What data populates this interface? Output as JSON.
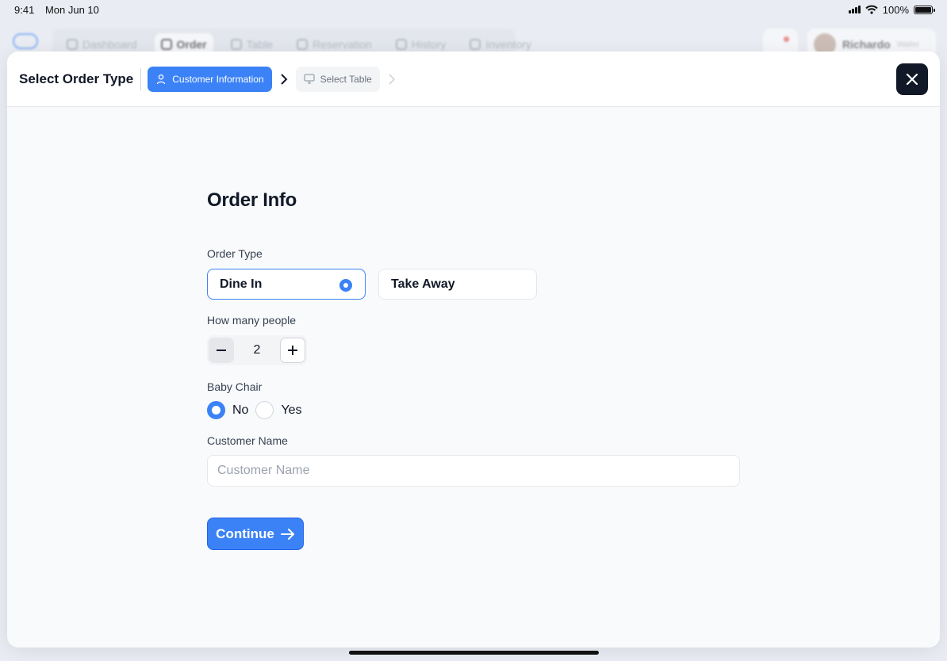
{
  "status_bar": {
    "time": "9:41",
    "date": "Mon Jun 10",
    "battery": "100%"
  },
  "background": {
    "tabs": [
      {
        "label": "Dashboard",
        "icon": "dashboard-icon",
        "active": false
      },
      {
        "label": "Order",
        "icon": "document-icon",
        "active": true
      },
      {
        "label": "Table",
        "icon": "monitor-icon",
        "active": false
      },
      {
        "label": "Reservation",
        "icon": "calendar-icon",
        "active": false
      },
      {
        "label": "History",
        "icon": "clock-icon",
        "active": false
      },
      {
        "label": "Inventory",
        "icon": "store-icon",
        "active": false
      }
    ],
    "user": {
      "name": "Richardo",
      "role": "Waiter"
    }
  },
  "modal": {
    "title": "Select Order Type",
    "steps": [
      {
        "label": "Customer Information",
        "icon": "user-icon",
        "active": true
      },
      {
        "label": "Select Table",
        "icon": "monitor-icon",
        "active": false
      }
    ],
    "close_icon": "close-icon"
  },
  "form": {
    "title": "Order Info",
    "order_type": {
      "label": "Order Type",
      "options": [
        "Dine In",
        "Take Away"
      ],
      "selected": "Dine In"
    },
    "people": {
      "label": "How many people",
      "value": "2"
    },
    "baby_chair": {
      "label": "Baby Chair",
      "options": [
        "No",
        "Yes"
      ],
      "selected": "No"
    },
    "customer_name": {
      "label": "Customer Name",
      "placeholder": "Customer Name",
      "value": ""
    },
    "continue_label": "Continue"
  },
  "colors": {
    "accent": "#3b82f6",
    "dark": "#111827",
    "modal_bg": "#f8fafc"
  }
}
